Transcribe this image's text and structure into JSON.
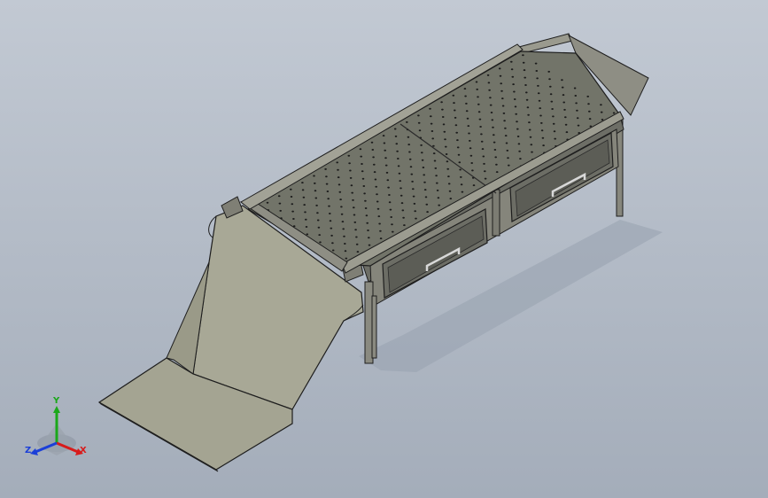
{
  "viewport": {
    "background_top": "#c2c9d3",
    "background_bottom": "#a4adba"
  },
  "model": {
    "body_color": "#8c8c80",
    "deck_color": "#74766c",
    "hole_color": "#1c1c1c",
    "chute_color": "#a6a694",
    "edge_color": "#1e1e1e",
    "drawer_count": 2,
    "leg_count": 4,
    "handle_icon": "drawer-handle-icon"
  },
  "triad": {
    "labels": {
      "x": "X",
      "y": "Y",
      "z": "Z"
    },
    "colors": {
      "x": "#d81b1b",
      "y": "#1aa81a",
      "z": "#1b3fd8"
    }
  }
}
